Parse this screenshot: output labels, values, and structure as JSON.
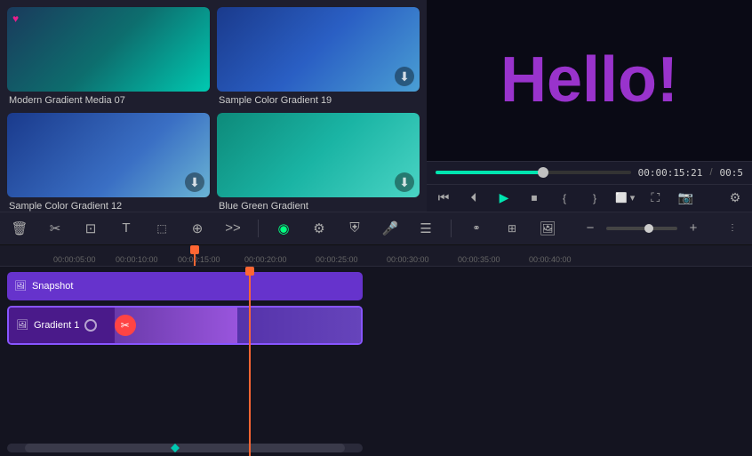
{
  "media_panel": {
    "items": [
      {
        "id": 1,
        "label": "Modern Gradient Media 07",
        "thumb_class": "thumb-1",
        "has_heart": true,
        "has_download": false
      },
      {
        "id": 2,
        "label": "Sample Color Gradient 19",
        "thumb_class": "thumb-2",
        "has_heart": false,
        "has_download": true
      },
      {
        "id": 3,
        "label": "Sample Color Gradient 12",
        "thumb_class": "thumb-3",
        "has_heart": false,
        "has_download": true
      },
      {
        "id": 4,
        "label": "Blue Green Gradient",
        "thumb_class": "thumb-4",
        "has_heart": false,
        "has_download": true
      }
    ]
  },
  "preview": {
    "hello_text": "Hello!",
    "current_time": "00:00:15:21",
    "total_time": "00:5"
  },
  "toolbar": {
    "tools": [
      "delete",
      "cut",
      "crop",
      "text",
      "transform",
      "effects",
      "more"
    ],
    "zoom_value": "60%"
  },
  "timeline": {
    "ruler_marks": [
      "00:00:05:00",
      "00:00:10:00",
      "00:00:15:00",
      "00:00:20:00",
      "00:00:25:00",
      "00:00:30:00",
      "00:00:35:00",
      "00:00:40:00"
    ],
    "tracks": [
      {
        "id": "snapshot",
        "label": "Snapshot",
        "type": "snapshot"
      },
      {
        "id": "gradient1",
        "label": "Gradient 1",
        "type": "gradient"
      }
    ]
  }
}
